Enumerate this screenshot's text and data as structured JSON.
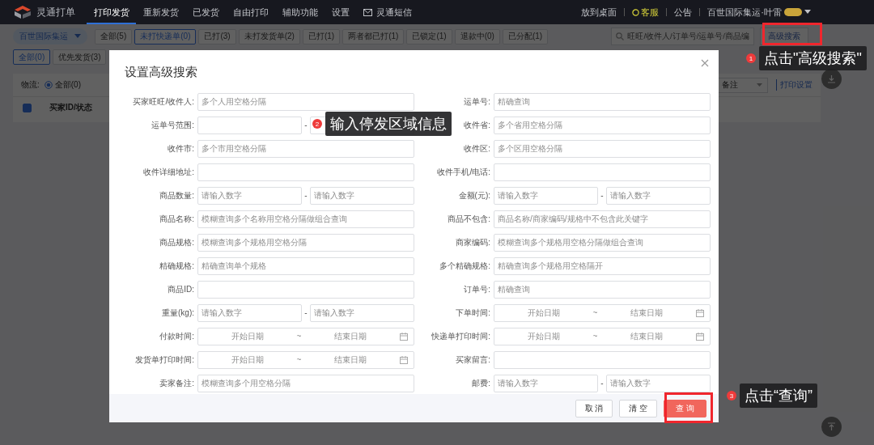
{
  "nav": {
    "logo": "灵通打单",
    "tabs": [
      {
        "label": "打印发货",
        "selected": true,
        "kind": "text"
      },
      {
        "label": "重新发货",
        "selected": false,
        "kind": "text"
      },
      {
        "label": "已发货",
        "selected": false,
        "kind": "text"
      },
      {
        "label": "自由打印",
        "selected": false,
        "kind": "text"
      },
      {
        "label": "辅助功能",
        "selected": false,
        "kind": "text"
      },
      {
        "label": "设置",
        "selected": false,
        "kind": "text"
      },
      {
        "label": "灵通短信",
        "selected": false,
        "kind": "mail"
      }
    ],
    "links": [
      {
        "label": "放到桌面",
        "kind": "plain"
      },
      {
        "label": "客服",
        "kind": "support"
      },
      {
        "label": "公告",
        "kind": "plain"
      }
    ],
    "account": "百世国际集运·叶雷"
  },
  "toolbar": {
    "carrier": "百世国际集运",
    "filters": [
      {
        "label": "全部(5)",
        "selected": false
      },
      {
        "label": "未打快递单(0)",
        "selected": true
      },
      {
        "label": "已打(3)",
        "selected": false
      },
      {
        "label": "未打发货单(2)",
        "selected": false
      },
      {
        "label": "已打(1)",
        "selected": false
      },
      {
        "label": "两者都已打(1)",
        "selected": false
      },
      {
        "label": "已锁定(1)",
        "selected": false
      },
      {
        "label": "退款中(0)",
        "selected": false
      },
      {
        "label": "已分配(1)",
        "selected": false
      }
    ],
    "search": {
      "placeholder": "旺旺/收件人/订单号/运单号/商品编"
    },
    "advanced_button": "高级搜索"
  },
  "subfilters": [
    {
      "label": "全部(0)",
      "selected": true
    },
    {
      "label": "优先发货(3)",
      "selected": false
    }
  ],
  "logistics": {
    "label": "物流:",
    "option": "全部(0)",
    "selected": true
  },
  "remark_select": "备注",
  "print_settings": "打印设置",
  "table": {
    "select_all_checked": true,
    "columns": [
      "买家ID/状态"
    ]
  },
  "dialog": {
    "title": "设置高级搜索",
    "fields_left": [
      {
        "label": "买家旺旺/收件人:",
        "kind": "text",
        "placeholder": "多个人用空格分隔"
      },
      {
        "label": "运单号范围:",
        "kind": "range",
        "separator": "-"
      },
      {
        "label": "收件市:",
        "kind": "text",
        "placeholder": "多个市用空格分隔"
      },
      {
        "label": "收件详细地址:",
        "kind": "text"
      },
      {
        "label": "商品数量:",
        "kind": "range",
        "separator": "-",
        "placeholders": [
          "请输入数字",
          "请输入数字"
        ]
      },
      {
        "label": "商品名称:",
        "kind": "text",
        "placeholder": "模糊查询多个名称用空格分隔做组合查询"
      },
      {
        "label": "商品规格:",
        "kind": "text",
        "placeholder": "模糊查询多个规格用空格分隔"
      },
      {
        "label": "精确规格:",
        "kind": "text",
        "placeholder": "精确查询单个规格"
      },
      {
        "label": "商品ID:",
        "kind": "text"
      },
      {
        "label": "重量(kg):",
        "kind": "range",
        "separator": "-",
        "placeholders": [
          "请输入数字",
          "请输入数字"
        ]
      },
      {
        "label": "付款时间:",
        "kind": "date",
        "start": "开始日期",
        "separator": "~",
        "end": "结束日期"
      },
      {
        "label": "发货单打印时间:",
        "kind": "date",
        "start": "开始日期",
        "separator": "~",
        "end": "结束日期"
      },
      {
        "label": "卖家备注:",
        "kind": "text",
        "placeholder": "模糊查询多个用空格分隔"
      }
    ],
    "fields_right": [
      {
        "label": "运单号:",
        "kind": "text",
        "placeholder": "精确查询"
      },
      {
        "label": "收件省:",
        "kind": "text",
        "placeholder": "多个省用空格分隔"
      },
      {
        "label": "收件区:",
        "kind": "text",
        "placeholder": "多个区用空格分隔"
      },
      {
        "label": "收件手机/电话:",
        "kind": "text"
      },
      {
        "label": "金额(元):",
        "kind": "range",
        "separator": "-",
        "placeholders": [
          "请输入数字",
          "请输入数字"
        ]
      },
      {
        "label": "商品不包含:",
        "kind": "text",
        "placeholder": "商品名称/商家编码/规格中不包含此关键字"
      },
      {
        "label": "商家编码:",
        "kind": "text",
        "placeholder": "模糊查询多个规格用空格分隔做组合查询"
      },
      {
        "label": "多个精确规格:",
        "kind": "text",
        "placeholder": "精确查询多个规格用空格隔开"
      },
      {
        "label": "订单号:",
        "kind": "text",
        "placeholder": "精确查询"
      },
      {
        "label": "下单时间:",
        "kind": "date",
        "start": "开始日期",
        "separator": "~",
        "end": "结束日期"
      },
      {
        "label": "快递单打印时间:",
        "kind": "date",
        "start": "开始日期",
        "separator": "~",
        "end": "结束日期"
      },
      {
        "label": "买家留言:",
        "kind": "text"
      },
      {
        "label": "邮费:",
        "kind": "range",
        "separator": "-",
        "placeholders": [
          "请输入数字",
          "请输入数字"
        ]
      }
    ],
    "buttons": [
      {
        "label": "取 消",
        "kind": "default"
      },
      {
        "label": "清 空",
        "kind": "default"
      },
      {
        "label": "查 询",
        "kind": "primary"
      }
    ]
  },
  "callouts": [
    {
      "number": "1",
      "text": "点击\"高级搜索\""
    },
    {
      "number": "2",
      "text": "输入停发区域信息"
    },
    {
      "number": "3",
      "text": "点击“查询”"
    }
  ]
}
